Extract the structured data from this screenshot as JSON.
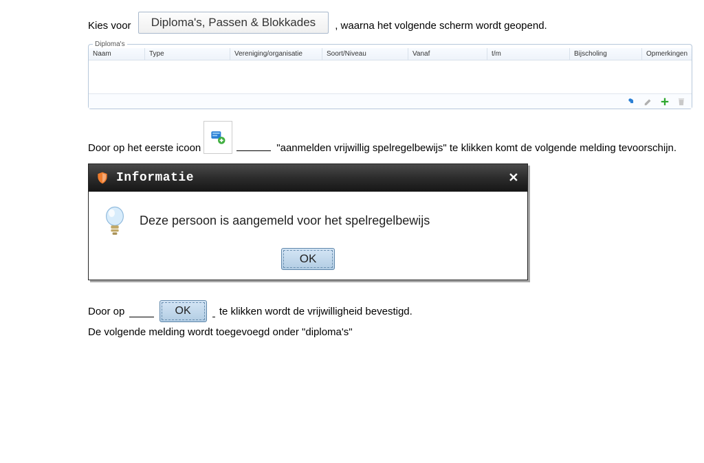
{
  "text": {
    "line1_before": "Kies voor ",
    "tab_label": "Diploma's, Passen & Blokkades",
    "line1_after": ", waarna het volgende scherm wordt geopend.",
    "line2_before": "Door op het eerste icoon",
    "line2_after_quoted": "\"aanmelden vrijwillig spelregelbewijs\"",
    "line2_tail": " te klikken komt de volgende melding tevoorschijn.",
    "line3_before": "Door op ",
    "line3_after": " te klikken wordt de vrijwilligheid bevestigd.",
    "line4": "De volgende melding wordt toegevoegd onder \"diploma's\""
  },
  "panel": {
    "legend": "Diploma's",
    "columns": [
      "Naam",
      "Type",
      "Vereniging/organisatie",
      "Soort/Niveau",
      "Vanaf",
      "t/m",
      "Bijscholing",
      "Opmerkingen"
    ]
  },
  "dialog": {
    "title": "Informatie",
    "message": "Deze persoon is aangemeld voor het spelregelbewijs",
    "ok": "OK"
  },
  "buttons": {
    "ok_inline": "OK"
  }
}
